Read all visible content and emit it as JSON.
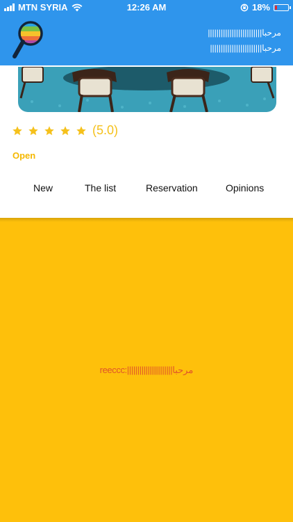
{
  "status_bar": {
    "carrier": "MTN SYRIA",
    "time": "12:26 AM",
    "battery": "18%",
    "battery_level": 0.18,
    "battery_color": "#e8292b"
  },
  "header": {
    "line1": "مرحبا|||||||||||||||||||||||||",
    "line2": "مرحبا||||||||||||||||||||||||",
    "background": "#2f95ec"
  },
  "venue": {
    "rating_stars": 5,
    "rating_text": "(5.0)",
    "status": "Open",
    "star_color": "#f5c11c"
  },
  "tabs": [
    {
      "label": "New"
    },
    {
      "label": "The list"
    },
    {
      "label": "Reservation"
    },
    {
      "label": "Opinions"
    }
  ],
  "content": {
    "background": "#fec00b",
    "text": "reeccc:||||||||||||||||||||||مرحبا"
  },
  "icons": [
    "signal-icon",
    "wifi-icon",
    "orientation-lock-icon",
    "battery-icon",
    "magnifier-logo-icon",
    "star-icon"
  ]
}
